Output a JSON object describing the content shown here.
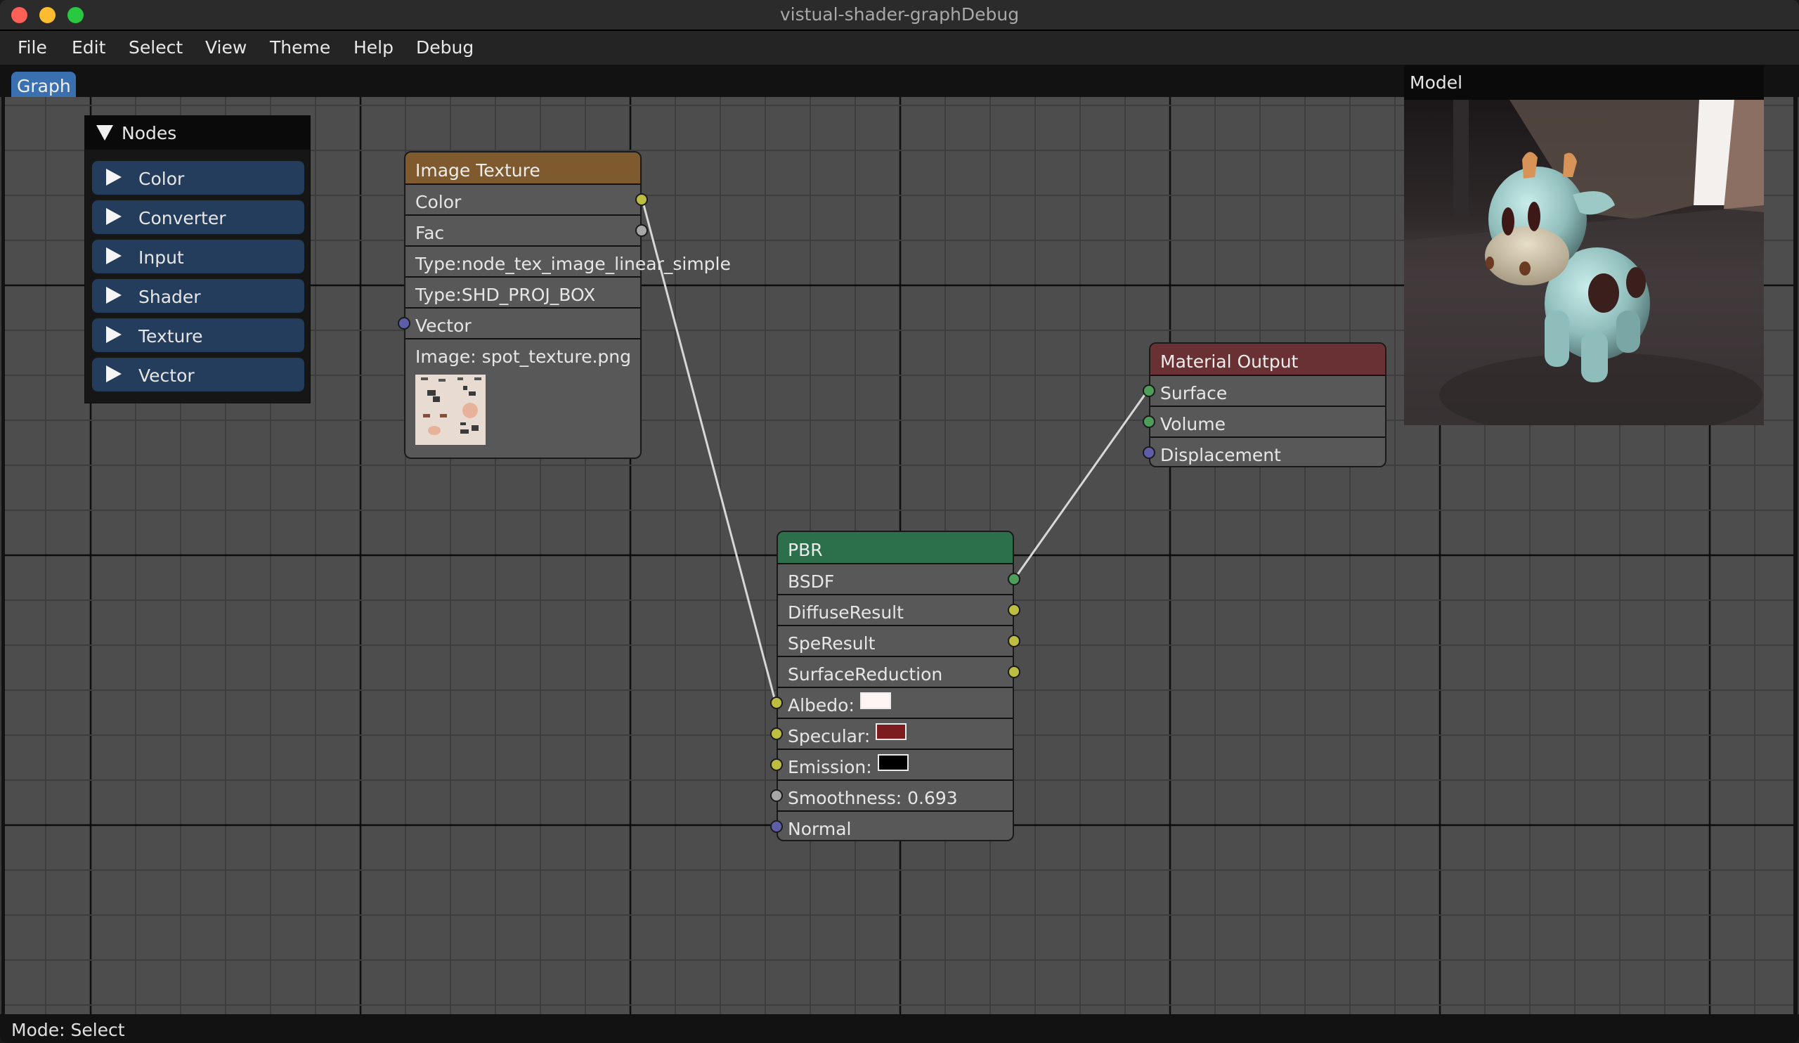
{
  "window": {
    "title": "vistual-shader-graphDebug",
    "buttons": [
      "close",
      "minimize",
      "maximize"
    ]
  },
  "menu": [
    "File",
    "Edit",
    "Select",
    "View",
    "Theme",
    "Help",
    "Debug"
  ],
  "tabs": [
    {
      "label": "Graph",
      "active": true
    }
  ],
  "nodes_panel": {
    "title": "Nodes",
    "expanded": true,
    "categories": [
      "Color",
      "Converter",
      "Input",
      "Shader",
      "Texture",
      "Vector"
    ]
  },
  "graph": {
    "nodes": {
      "image_texture": {
        "title": "Image Texture",
        "header_color": "#7f5a2e",
        "rows": [
          {
            "label": "Color",
            "socket": "output",
            "socket_color": "#bdbd3f"
          },
          {
            "label": "Fac",
            "socket": "output",
            "socket_color": "#a6a6a6"
          },
          {
            "label": "Type:node_tex_image_linear_simple"
          },
          {
            "label": "Type:SHD_PROJ_BOX"
          },
          {
            "label": "Vector",
            "socket": "input",
            "socket_color": "#5e5ea8"
          }
        ],
        "image_label": "Image: spot_texture.png",
        "image_name": "spot_texture.png"
      },
      "pbr": {
        "title": "PBR",
        "header_color": "#2b6f4b",
        "rows": [
          {
            "label": "BSDF",
            "socket": "output",
            "socket_color": "#4c9e59"
          },
          {
            "label": "DiffuseResult",
            "socket": "output",
            "socket_color": "#bdbd3f"
          },
          {
            "label": "SpeResult",
            "socket": "output",
            "socket_color": "#bdbd3f"
          },
          {
            "label": "SurfaceReduction",
            "socket": "output",
            "socket_color": "#bdbd3f"
          },
          {
            "label": "Albedo:",
            "socket": "input",
            "socket_color": "#bdbd3f",
            "swatch": "#fff6f4"
          },
          {
            "label": "Specular:",
            "socket": "input",
            "socket_color": "#bdbd3f",
            "swatch": "#7d1c1f"
          },
          {
            "label": "Emission:",
            "socket": "input",
            "socket_color": "#bdbd3f",
            "swatch": "#000000"
          },
          {
            "label": "Smoothness: 0.693",
            "socket": "input",
            "socket_color": "#a6a6a6"
          },
          {
            "label": "Normal",
            "socket": "input",
            "socket_color": "#5e5ea8"
          }
        ],
        "smoothness": 0.693
      },
      "material_output": {
        "title": "Material Output",
        "header_color": "#6a3134",
        "rows": [
          {
            "label": "Surface",
            "socket": "input",
            "socket_color": "#4c9e59"
          },
          {
            "label": "Volume",
            "socket": "input",
            "socket_color": "#4c9e59"
          },
          {
            "label": "Displacement",
            "socket": "input",
            "socket_color": "#5e5ea8"
          }
        ]
      }
    },
    "links": [
      {
        "from": "Image Texture.Color",
        "to": "PBR.Albedo"
      },
      {
        "from": "PBR.BSDF",
        "to": "Material Output.Surface"
      }
    ]
  },
  "model_panel": {
    "title": "Model"
  },
  "status": {
    "text": "Mode: Select"
  },
  "colors": {
    "canvas_bg": "#4d4d4d",
    "tab_active": "#3a6fb0",
    "category_button": "#243d5c",
    "link": "#d8d8d8"
  }
}
